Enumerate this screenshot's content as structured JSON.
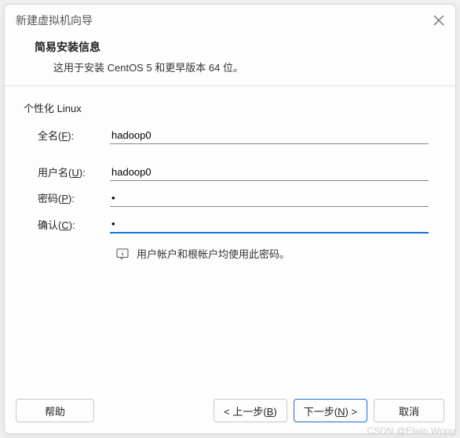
{
  "window": {
    "title": "新建虚拟机向导"
  },
  "header": {
    "title": "简易安装信息",
    "subtitle": "这用于安装 CentOS 5 和更早版本 64 位。"
  },
  "section": {
    "label": "个性化 Linux"
  },
  "form": {
    "fullname_label_pre": "全名(",
    "fullname_key": "F",
    "fullname_label_post": "):",
    "fullname_value": "hadoop0",
    "username_label_pre": "用户名(",
    "username_key": "U",
    "username_label_post": "):",
    "username_value": "hadoop0",
    "password_label_pre": "密码(",
    "password_key": "P",
    "password_label_post": "):",
    "password_value": "•",
    "confirm_label_pre": "确认(",
    "confirm_key": "C",
    "confirm_label_post": "):",
    "confirm_value": "•",
    "note": "用户帐户和根帐户均使用此密码。"
  },
  "buttons": {
    "help": "帮助",
    "back_pre": "< 上一步(",
    "back_key": "B",
    "back_post": ")",
    "next_pre": "下一步(",
    "next_key": "N",
    "next_post": ") >",
    "cancel": "取消"
  },
  "watermark": "CSDN @Elwin Wong"
}
